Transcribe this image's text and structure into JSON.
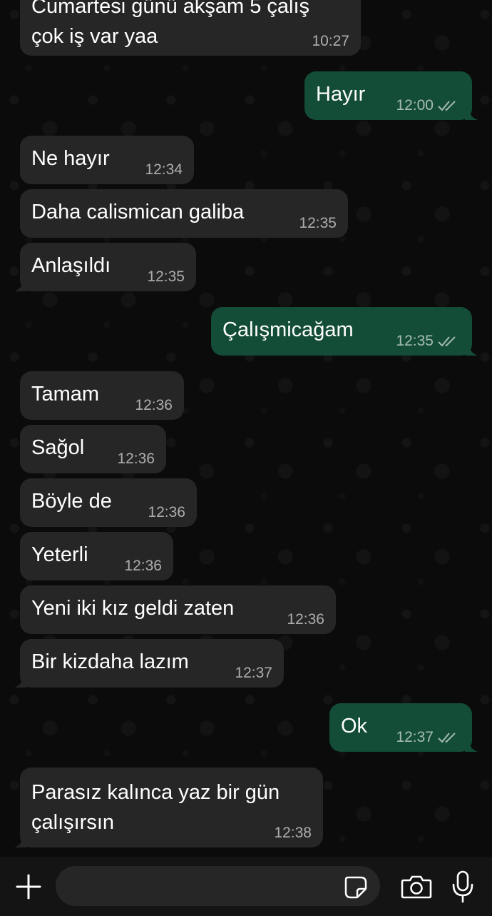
{
  "chat": {
    "messages": [
      {
        "dir": "in",
        "text": "Cumartesi günü akşam 5 çalış\nçok iş var yaa",
        "time": "10:27"
      },
      {
        "dir": "out",
        "text": "Hayır",
        "time": "12:00",
        "read": true
      },
      {
        "dir": "in",
        "text": "Ne hayır",
        "time": "12:34"
      },
      {
        "dir": "in",
        "text": "Daha calismican galiba",
        "time": "12:35"
      },
      {
        "dir": "in",
        "text": "Anlaşıldı",
        "time": "12:35"
      },
      {
        "dir": "out",
        "text": "Çalışmicağam",
        "time": "12:35",
        "read": true
      },
      {
        "dir": "in",
        "text": "Tamam",
        "time": "12:36"
      },
      {
        "dir": "in",
        "text": "Sağol",
        "time": "12:36"
      },
      {
        "dir": "in",
        "text": "Böyle de",
        "time": "12:36"
      },
      {
        "dir": "in",
        "text": "Yeterli",
        "time": "12:36"
      },
      {
        "dir": "in",
        "text": "Yeni iki kız geldi zaten",
        "time": "12:36"
      },
      {
        "dir": "in",
        "text": "Bir kizdaha lazım",
        "time": "12:37"
      },
      {
        "dir": "out",
        "text": "Ok",
        "time": "12:37",
        "read": true
      },
      {
        "dir": "in",
        "text": "Parasız kalınca yaz bir gün\nçalışırsın",
        "time": "12:38"
      }
    ]
  },
  "composer": {
    "input_value": "",
    "icons": {
      "attach": "plus-icon",
      "sticker": "sticker-icon",
      "camera": "camera-icon",
      "mic": "microphone-icon"
    }
  },
  "colors": {
    "background": "#0b0b0b",
    "incoming_bubble": "#262626",
    "outgoing_bubble": "#134d37",
    "composer_bar": "#141414"
  }
}
